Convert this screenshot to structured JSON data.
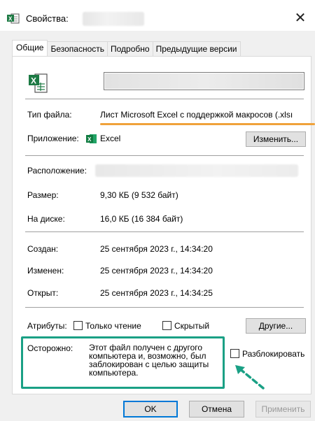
{
  "window": {
    "title": "Свойства:",
    "close_symbol": "✕"
  },
  "tabs": [
    "Общие",
    "Безопасность",
    "Подробно",
    "Предыдущие версии"
  ],
  "general": {
    "file_type_label": "Тип файла:",
    "file_type_value": "Лист Microsoft Excel с поддержкой макросов (.xlsı",
    "app_label": "Приложение:",
    "app_value": "Excel",
    "change_button": "Изменить...",
    "location_label": "Расположение:",
    "size_label": "Размер:",
    "size_value": "9,30 КБ (9 532 байт)",
    "disk_label": "На диске:",
    "disk_value": "16,0 КБ (16 384 байт)",
    "created_label": "Создан:",
    "created_value": "25 сентября 2023 г., 14:34:20",
    "modified_label": "Изменен:",
    "modified_value": "25 сентября 2023 г., 14:34:20",
    "opened_label": "Открыт:",
    "opened_value": "25 сентября 2023 г., 14:34:25",
    "attributes_label": "Атрибуты:",
    "readonly_label": "Только чтение",
    "hidden_label": "Скрытый",
    "other_button": "Другие...",
    "warning_label": "Осторожно:",
    "warning_text": "Этот файл получен с другого компьютера и, возможно, был заблокирован с целью защиты компьютера.",
    "unblock_label": "Разблокировать"
  },
  "buttons": {
    "ok": "OK",
    "cancel": "Отмена",
    "apply": "Применить"
  },
  "colors": {
    "highlight_underline": "#f0a23b",
    "annotation": "#1aa085",
    "excel_green": "#1d7a44",
    "focus_blue": "#0078d7"
  },
  "icons": {
    "title": "excel-file-icon",
    "file": "excel-file-icon",
    "app": "excel-app-icon",
    "arrow": "dashed-arrow-icon"
  }
}
